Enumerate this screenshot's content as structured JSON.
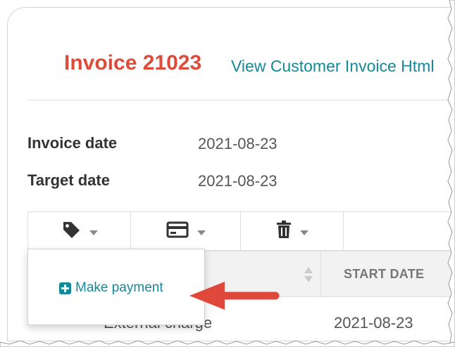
{
  "invoice": {
    "title": "Invoice 21023",
    "view_link": "View Customer Invoice Html"
  },
  "fields": [
    {
      "label": "Invoice date",
      "value": "2021-08-23"
    },
    {
      "label": "Target date",
      "value": "2021-08-23"
    }
  ],
  "toolbar": {
    "buttons": [
      {
        "icon": "tag-icon"
      },
      {
        "icon": "credit-card-icon"
      },
      {
        "icon": "trash-icon"
      }
    ]
  },
  "table": {
    "columns": [
      "",
      "START DATE"
    ],
    "rows": [
      {
        "description": "External charge",
        "start_date": "2021-08-23"
      }
    ]
  },
  "dropdown": {
    "items": [
      {
        "icon": "plus-square-icon",
        "label": "Make payment"
      }
    ]
  },
  "colors": {
    "title": "#dd4b39",
    "link": "#15889a",
    "arrow": "#e0483c"
  }
}
